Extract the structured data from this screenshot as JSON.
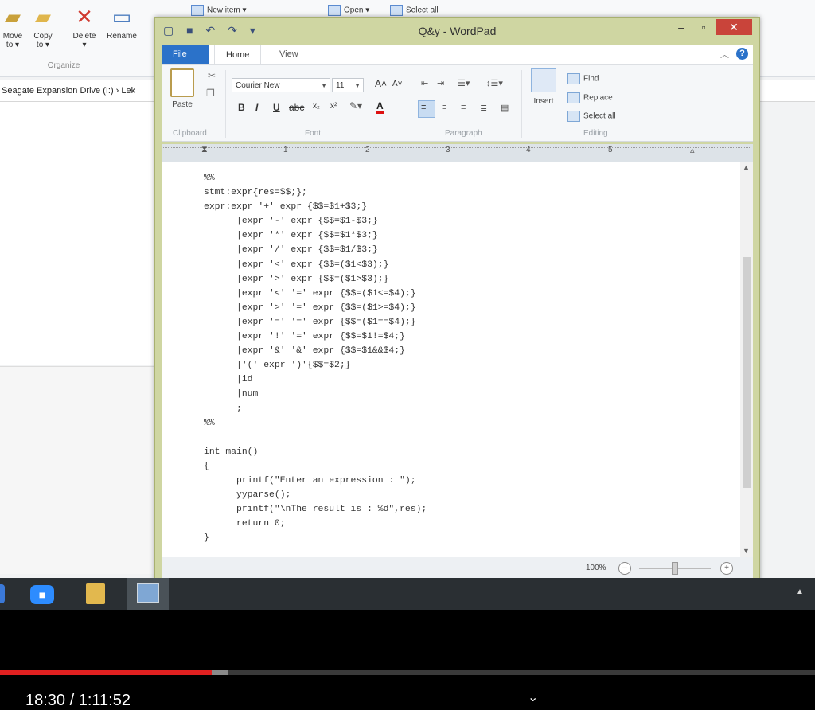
{
  "explorer": {
    "buttons": [
      {
        "label": "Move\nto ▾"
      },
      {
        "label": "Copy\nto ▾"
      },
      {
        "label": "Delete\n▾"
      },
      {
        "label": "Rename"
      }
    ],
    "new_item": "New item ▾",
    "open": "Open ▾",
    "select_all": "Select all",
    "group_label": "Organize",
    "address": "Seagate Expansion Drive (I:)  ›  Lek"
  },
  "wordpad": {
    "title": "Q&y - WordPad",
    "tabs": {
      "file": "File",
      "home": "Home",
      "view": "View"
    },
    "clipboard": {
      "paste": "Paste",
      "group": "Clipboard"
    },
    "font": {
      "family": "Courier New",
      "size": "11",
      "group": "Font"
    },
    "paragraph": {
      "group": "Paragraph"
    },
    "insert": {
      "label": "Insert"
    },
    "editing": {
      "find": "Find",
      "replace": "Replace",
      "select_all": "Select all",
      "group": "Editing"
    },
    "ruler": {
      "numbers": [
        "1",
        "2",
        "3",
        "4",
        "5"
      ]
    },
    "document": {
      "lines": [
        "%%",
        "stmt:expr{res=$$;};",
        "expr:expr '+' expr {$$=$1+$3;}",
        "      |expr '-' expr {$$=$1-$3;}",
        "      |expr '*' expr {$$=$1*$3;}",
        "      |expr '/' expr {$$=$1/$3;}",
        "      |expr '<' expr {$$=($1<$3);}",
        "      |expr '>' expr {$$=($1>$3);}",
        "      |expr '<' '=' expr {$$=($1<=$4);}",
        "      |expr '>' '=' expr {$$=($1>=$4);}",
        "      |expr '=' '=' expr {$$=($1==$4);}",
        "      |expr '!' '=' expr {$$=$1!=$4;}",
        "      |expr '&' '&' expr {$$=$1&&$4;}",
        "      |'(' expr ')'{$$=$2;}",
        "      |id",
        "      |num",
        "      ;",
        "%%",
        "",
        "int main()",
        "{",
        "      printf(\"Enter an expression : \");",
        "      yyparse();",
        "      printf(\"\\nThe result is : %d\",res);",
        "      return 0;",
        "}"
      ]
    },
    "zoom": "100%"
  },
  "player": {
    "time": "18:30 / 1:11:52",
    "played_fraction": 0.26,
    "buffered_fraction": 0.28
  }
}
